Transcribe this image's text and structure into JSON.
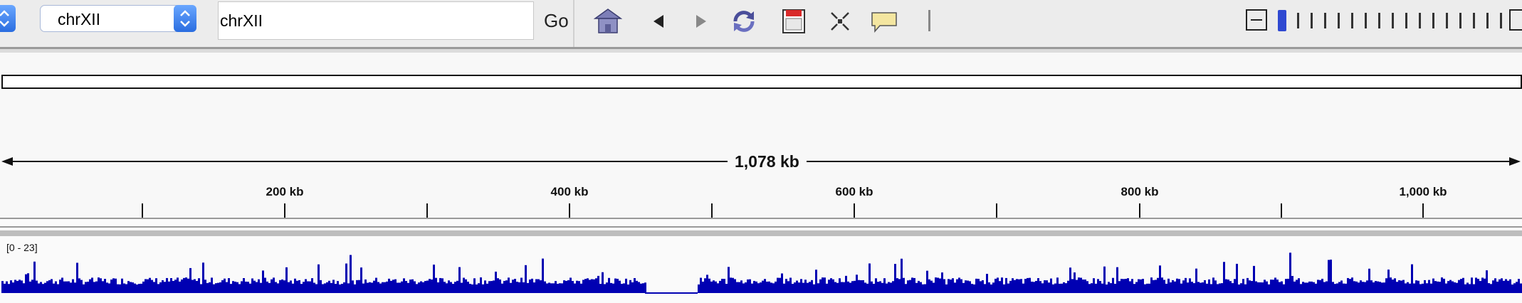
{
  "toolbar": {
    "genome_selector_stepper": "stepper-icon",
    "chromosome": "chrXII",
    "locus": "chrXII",
    "go_label": "Go",
    "icons": [
      "home-icon",
      "back-icon",
      "forward-icon",
      "refresh-icon",
      "region-navigator-icon",
      "fit-to-window-icon",
      "popup-info-icon",
      "roi-divider-icon"
    ]
  },
  "ruler": {
    "span_label": "1,078 kb",
    "tick_labels": [
      "200 kb",
      "400 kb",
      "600 kb",
      "800 kb",
      "1,000 kb"
    ]
  },
  "track": {
    "data_range": "[0 - 23]",
    "color": "#0000b2"
  },
  "colors": {
    "stepper": "#2a6de0",
    "zoom_current": "#2f49d1"
  }
}
